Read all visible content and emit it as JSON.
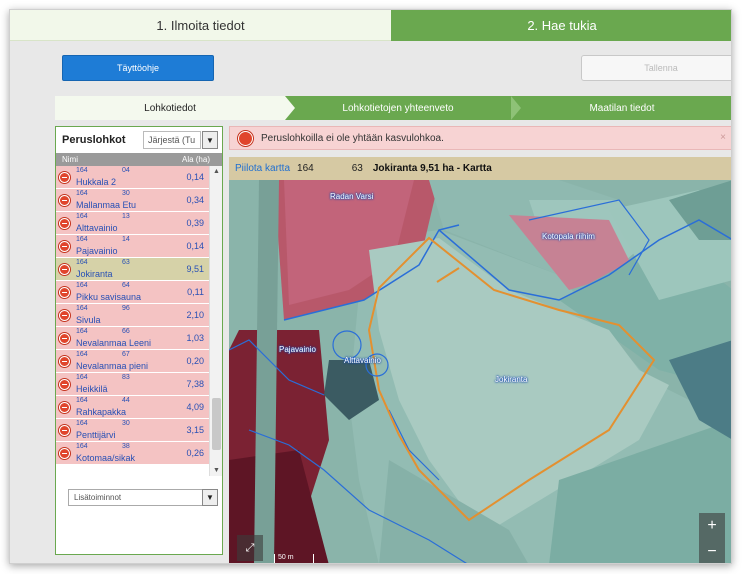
{
  "steps": [
    {
      "label": "1. Ilmoita tiedot"
    },
    {
      "label": "2. Hae tukia"
    }
  ],
  "toolbar": {
    "help_label": "Täyttöohje",
    "save_label": "Tallenna"
  },
  "subtabs": [
    {
      "label": "Lohkotiedot"
    },
    {
      "label": "Lohkotietojen yhteenveto"
    },
    {
      "label": "Maatilan tiedot"
    }
  ],
  "panel": {
    "title": "Peruslohkot",
    "sort_value": "Järjestä (Tu",
    "col_name": "Nimi",
    "col_area": "Ala (ha)",
    "actions_value": "Lisätoiminnot"
  },
  "rows": [
    {
      "code1": "164",
      "code2": "04",
      "name": "Hukkala 2",
      "area": "0,14"
    },
    {
      "code1": "164",
      "code2": "30",
      "name": "Mallanmaa Etu",
      "area": "0,34"
    },
    {
      "code1": "164",
      "code2": "13",
      "name": "Alttavainio",
      "area": "0,39"
    },
    {
      "code1": "164",
      "code2": "14",
      "name": "Pajavainio",
      "area": "0,14"
    },
    {
      "code1": "164",
      "code2": "63",
      "name": "Jokiranta",
      "area": "9,51",
      "selected": true
    },
    {
      "code1": "164",
      "code2": "64",
      "name": "Pikku savisauna",
      "area": "0,11"
    },
    {
      "code1": "164",
      "code2": "96",
      "name": "Sivula",
      "area": "2,10"
    },
    {
      "code1": "164",
      "code2": "66",
      "name": "Nevalanmaa Leeni",
      "area": "1,03"
    },
    {
      "code1": "164",
      "code2": "67",
      "name": "Nevalanmaa pieni",
      "area": "0,20"
    },
    {
      "code1": "164",
      "code2": "83",
      "name": "Heikkilä",
      "area": "7,38"
    },
    {
      "code1": "164",
      "code2": "44",
      "name": "Rahkapakka",
      "area": "4,09"
    },
    {
      "code1": "164",
      "code2": "30",
      "name": "Penttijärvi",
      "area": "3,15"
    },
    {
      "code1": "164",
      "code2": "38",
      "name": "Kotomaa/sikak",
      "area": "0,26"
    }
  ],
  "alert": {
    "text": "Peruslohkoilla ei ole yhtään kasvulohkoa.",
    "close": "×"
  },
  "mapbar": {
    "hide_link": "Piilota kartta",
    "code1": "164",
    "code2": "63",
    "title": "Jokiranta 9,51 ha - Kartta"
  },
  "map": {
    "labels": {
      "radan_varsi": "Radan Varsi",
      "kotopalo": "Kotopala riihim",
      "pajavainio": "Pajavainio",
      "alttavainio": "Alttavainio",
      "jokiranta": "Jokiranta"
    },
    "zoom_in": "+",
    "zoom_out": "−",
    "scale": "50 m",
    "expand_icon": "⤢"
  },
  "colors": {
    "green": "#6aa84f",
    "blue": "#1e7cd6",
    "alert_bg": "#f7d3d3",
    "row_bg": "#f4c3c3",
    "row_selected": "#d6d2a8"
  }
}
